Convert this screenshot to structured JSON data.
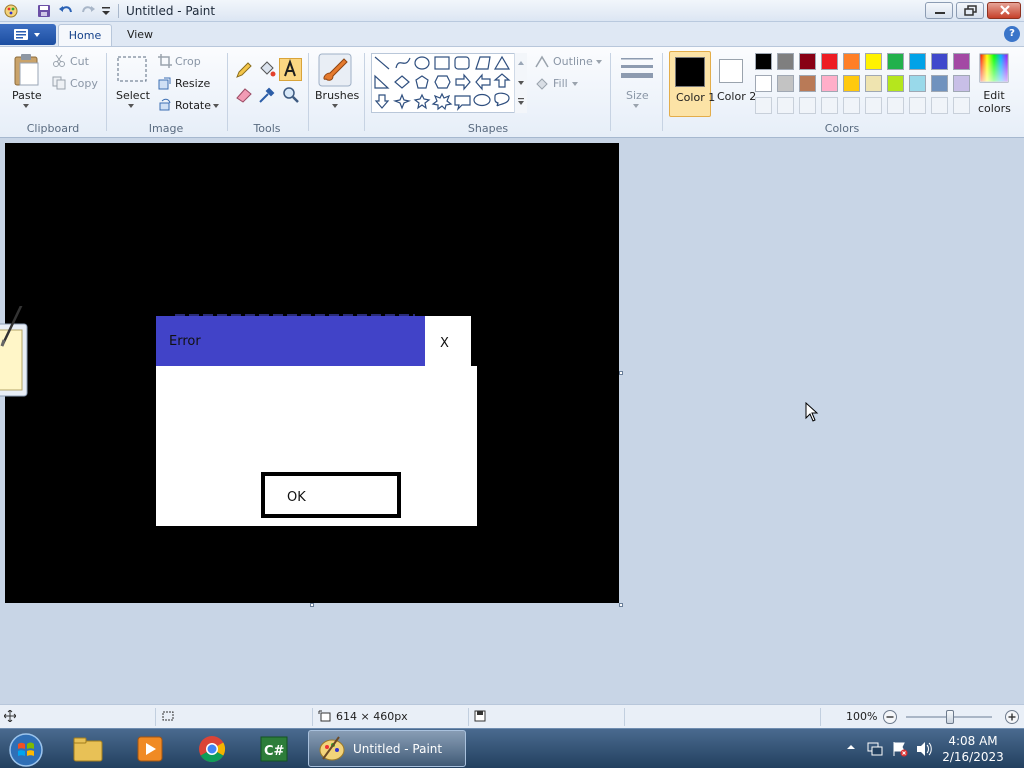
{
  "window": {
    "title": "Untitled - Paint"
  },
  "tabs": [
    {
      "label": "Home",
      "active": true
    },
    {
      "label": "View",
      "active": false
    }
  ],
  "ribbon": {
    "clipboard": {
      "label": "Clipboard",
      "paste": "Paste",
      "cut": "Cut",
      "copy": "Copy"
    },
    "image": {
      "label": "Image",
      "select": "Select",
      "crop": "Crop",
      "resize": "Resize",
      "rotate": "Rotate"
    },
    "tools": {
      "label": "Tools"
    },
    "brushes": {
      "label": "Brushes"
    },
    "shapes": {
      "label": "Shapes",
      "outline": "Outline",
      "fill": "Fill"
    },
    "size": {
      "label": "Size"
    },
    "colors": {
      "label": "Colors",
      "color1": "Color 1",
      "color1_value": "#000000",
      "color2": "Color 2",
      "color2_value": "#ffffff",
      "edit": "Edit colors",
      "palette_row1": [
        "#000000",
        "#7f7f7f",
        "#880015",
        "#ed1c24",
        "#ff7f27",
        "#fff200",
        "#22b14c",
        "#00a2e8",
        "#3f48cc",
        "#a349a4"
      ],
      "palette_row2": [
        "#ffffff",
        "#c3c3c3",
        "#b97a57",
        "#ffaec9",
        "#ffc90e",
        "#efe4b0",
        "#b5e61d",
        "#99d9ea",
        "#7092be",
        "#c8bfe7"
      ]
    }
  },
  "canvas_drawing": {
    "dialog_title": "Error",
    "dialog_close": "X",
    "dialog_button": "OK"
  },
  "status": {
    "dimensions": "614 × 460px",
    "zoom": "100%"
  },
  "taskbar": {
    "active_app": "Untitled - Paint",
    "time": "4:08 AM",
    "date": "2/16/2023"
  }
}
